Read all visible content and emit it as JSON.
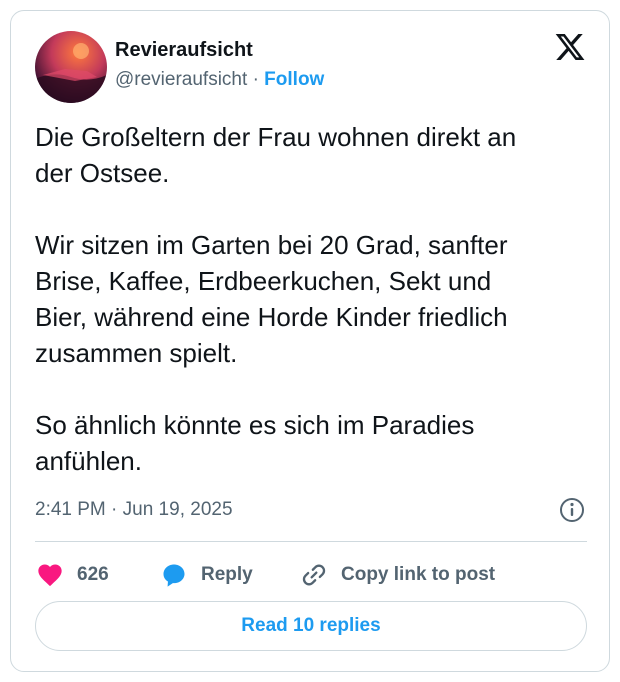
{
  "tweet": {
    "display_name": "Revieraufsicht",
    "handle": "@revieraufsicht",
    "separator": "·",
    "follow_label": "Follow",
    "text": "Die Großeltern der Frau wohnen direkt an\nder Ostsee.\n\nWir sitzen im Garten bei 20 Grad, sanfter\nBrise, Kaffee, Erdbeerkuchen, Sekt und\nBier, während eine Horde Kinder friedlich\nzusammen spielt.\n\nSo ähnlich könnte es sich im Paradies\nanfühlen.",
    "timestamp": "2:41 PM · Jun 19, 2025"
  },
  "actions": {
    "like_count": "626",
    "reply_label": "Reply",
    "copy_label": "Copy link to post"
  },
  "read_replies_label": "Read 10 replies",
  "icons": {
    "brand": "x-logo-icon",
    "info": "info-icon",
    "like": "heart-icon",
    "reply": "speech-bubble-icon",
    "copy": "link-icon"
  },
  "colors": {
    "accent": "#1d9bf0",
    "heart": "#f91880",
    "text": "#0f1419",
    "muted": "#536471",
    "border": "#cfd9de"
  }
}
